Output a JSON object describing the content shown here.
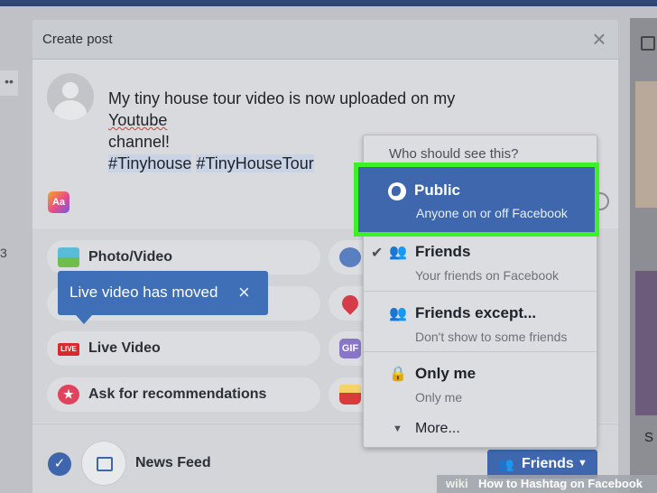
{
  "dialog": {
    "title": "Create post",
    "close_symbol": "×"
  },
  "compose": {
    "text_line1_a": "My tiny house tour video is now uploaded on my ",
    "text_line1_b": "Youtube",
    "text_line2": "channel!",
    "tag1": "#Tinyhouse",
    "tag2": "#TinyHouseTour",
    "text_style_icon": "Aa"
  },
  "options": {
    "photo_video": "Photo/Video",
    "live_video": "Live Video",
    "live_badge": "LIVE",
    "ask_recommendations": "Ask for recommendations",
    "gif_badge": "GIF"
  },
  "tooltip": {
    "text": "Live video has moved",
    "close_symbol": "×"
  },
  "footer": {
    "news_feed": "News Feed",
    "audience_button": "Friends"
  },
  "dropdown": {
    "header": "Who should see this?",
    "items": [
      {
        "name": "Public",
        "description": "Anyone on or off Facebook",
        "icon": "globe-icon",
        "selected_highlight": true
      },
      {
        "name": "Friends",
        "description": "Your friends on Facebook",
        "icon": "friends-icon",
        "checked": true
      },
      {
        "name": "Friends except...",
        "description": "Don't show to some friends",
        "icon": "friends-except-icon"
      },
      {
        "name": "Only me",
        "description": "Only me",
        "icon": "lock-icon"
      }
    ],
    "more": "More..."
  },
  "background": {
    "left_number": "3",
    "right_letter": "S"
  },
  "watermark": {
    "brand": "wiki",
    "text": "How to Hashtag on Facebook"
  },
  "colors": {
    "facebook_blue": "#3e67ad",
    "highlight_green": "#3df027",
    "tooltip_blue": "#3e6fb7"
  }
}
